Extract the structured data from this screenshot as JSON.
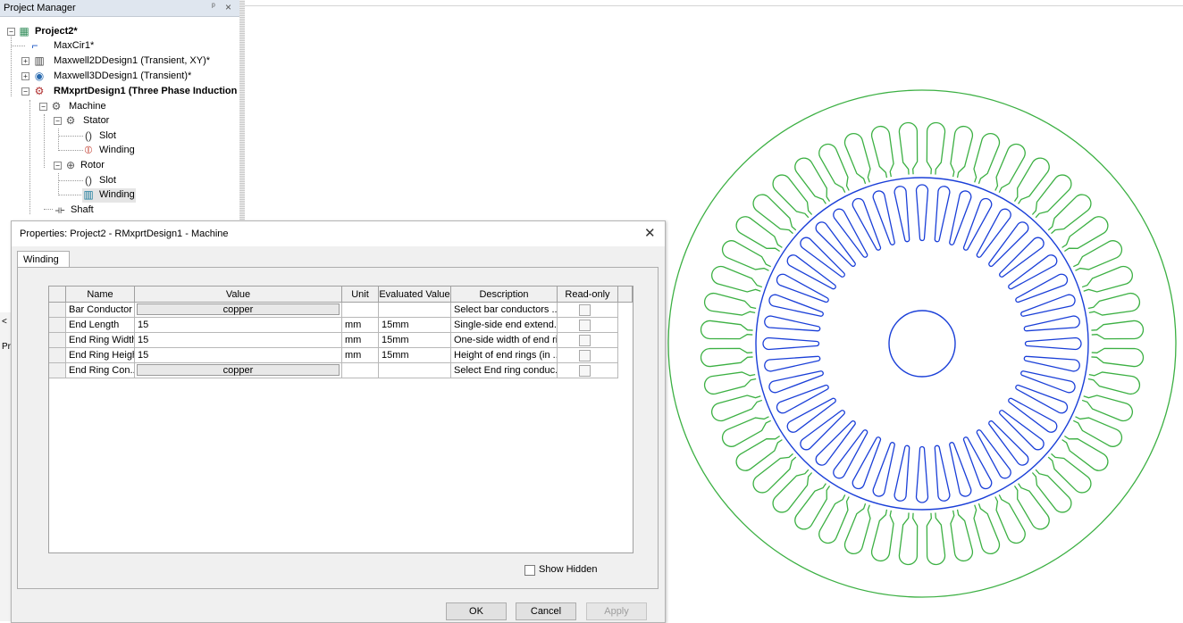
{
  "project_manager": {
    "title": "Project Manager",
    "pin_glyph": "ᵖ",
    "close_glyph": "×",
    "tree": {
      "project": "Project2*",
      "items": [
        {
          "label": "MaxCir1*"
        },
        {
          "label": "Maxwell2DDesign1 (Transient, XY)*"
        },
        {
          "label": "Maxwell3DDesign1 (Transient)*"
        },
        {
          "label": "RMxprtDesign1 (Three Phase Induction"
        }
      ],
      "machine": "Machine",
      "stator": "Stator",
      "stator_slot": "Slot",
      "stator_winding": "Winding",
      "rotor": "Rotor",
      "rotor_slot": "Slot",
      "rotor_winding": "Winding",
      "shaft": "Shaft"
    }
  },
  "side_stub": {
    "top_char": "<",
    "bottom_char": "Pr"
  },
  "dialog": {
    "title": "Properties: Project2 - RMxprtDesign1 - Machine",
    "close_glyph": "✕",
    "tab": "Winding",
    "columns": [
      "Name",
      "Value",
      "Unit",
      "Evaluated Value",
      "Description",
      "Read-only"
    ],
    "rows": [
      {
        "name": "Bar Conductor ...",
        "value": "copper",
        "value_is_button": true,
        "unit": "",
        "evaluated": "",
        "description": "Select bar conductors ..."
      },
      {
        "name": "End Length",
        "value": "15",
        "value_is_button": false,
        "unit": "mm",
        "evaluated": "15mm",
        "description": "Single-side end extend..."
      },
      {
        "name": "End Ring Width",
        "value": "15",
        "value_is_button": false,
        "unit": "mm",
        "evaluated": "15mm",
        "description": "One-side width of end ri..."
      },
      {
        "name": "End Ring Height",
        "value": "15",
        "value_is_button": false,
        "unit": "mm",
        "evaluated": "15mm",
        "description": "Height of  end rings (in ..."
      },
      {
        "name": "End Ring Con...",
        "value": "copper",
        "value_is_button": true,
        "unit": "",
        "evaluated": "",
        "description": "Select End ring conduc..."
      }
    ],
    "show_hidden_label": "Show Hidden",
    "ok_label": "OK",
    "cancel_label": "Cancel",
    "apply_label": "Apply"
  },
  "motor_view": {
    "stator_color": "#3cb043",
    "rotor_color": "#1a3fd8",
    "stator_slots": 48,
    "rotor_slots": 44
  }
}
